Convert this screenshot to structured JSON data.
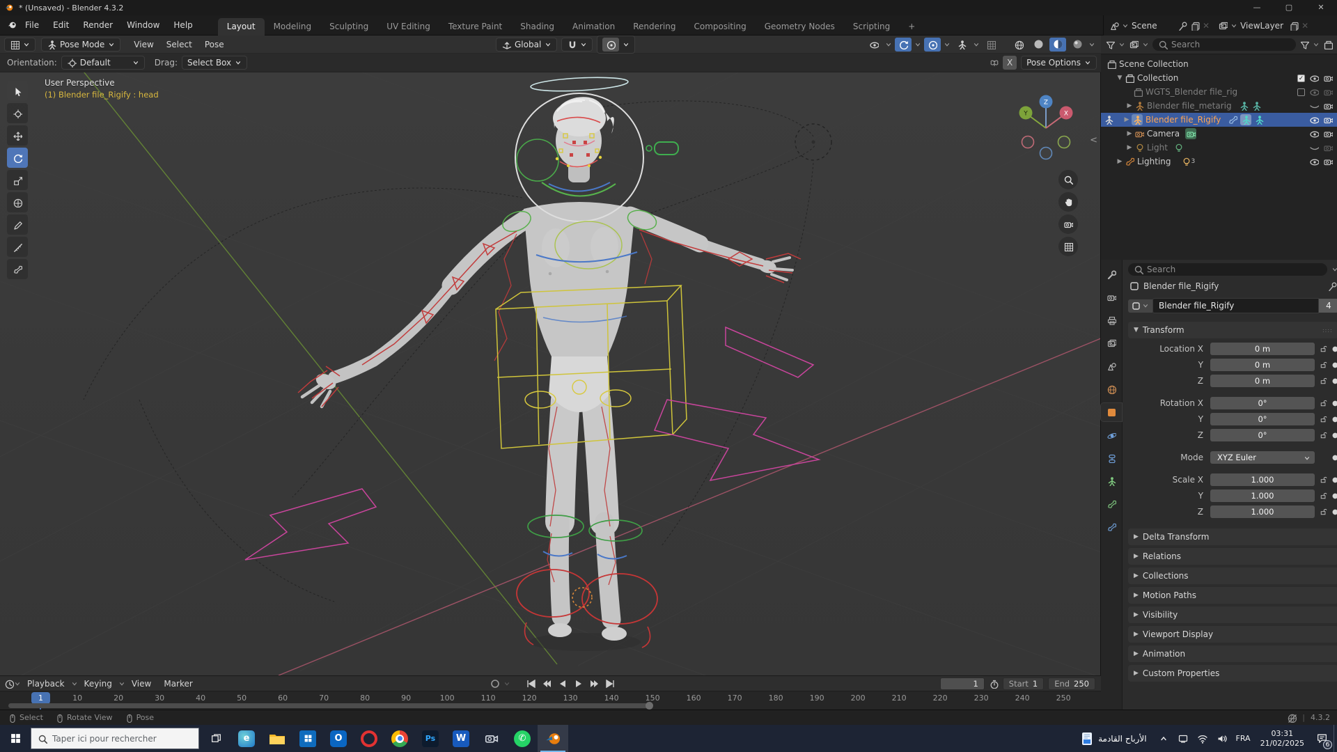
{
  "window": {
    "title": "* (Unsaved) - Blender 4.3.2",
    "minimize": "—",
    "maximize": "▢",
    "close": "✕"
  },
  "menubar": {
    "menus": [
      "File",
      "Edit",
      "Render",
      "Window",
      "Help"
    ],
    "workspaces": [
      "Layout",
      "Modeling",
      "Sculpting",
      "UV Editing",
      "Texture Paint",
      "Shading",
      "Animation",
      "Rendering",
      "Compositing",
      "Geometry Nodes",
      "Scripting"
    ],
    "active_workspace": "Layout",
    "add_tab": "+",
    "scene": "Scene",
    "viewlayer": "ViewLayer"
  },
  "tool_header": {
    "mode": "Pose Mode",
    "menus": [
      "View",
      "Select",
      "Pose"
    ],
    "orientation": "Global"
  },
  "options_row": {
    "orientation_label": "Orientation:",
    "orientation_value": "Default",
    "drag_label": "Drag:",
    "drag_value": "Select Box",
    "mirror_x": "X",
    "pose_options": "Pose Options"
  },
  "viewport": {
    "perspective_label": "User Perspective",
    "active_object_label": "(1) Blender file_Rigify : head",
    "gizmo": {
      "x": "X",
      "y": "Y",
      "z": "Z"
    },
    "collapse_arrow": "<"
  },
  "outliner": {
    "search_placeholder": "Search",
    "rows": [
      {
        "label": "Scene Collection"
      },
      {
        "label": "Collection"
      },
      {
        "label": "WGTS_Blender file_rig"
      },
      {
        "label": "Blender file_metarig"
      },
      {
        "label": "Blender file_Rigify"
      },
      {
        "label": "Camera"
      },
      {
        "label": "Light"
      },
      {
        "label": "Lighting",
        "badge": "3"
      }
    ]
  },
  "properties": {
    "search_placeholder": "Search",
    "breadcrumb": "Blender file_Rigify",
    "object_name": "Blender file_Rigify",
    "users_count": "4",
    "transform_title": "Transform",
    "transform_rows": [
      {
        "label": "Location X",
        "value": "0 m"
      },
      {
        "label": "Y",
        "value": "0 m"
      },
      {
        "label": "Z",
        "value": "0 m"
      },
      {
        "label": "Rotation X",
        "value": "0°"
      },
      {
        "label": "Y",
        "value": "0°"
      },
      {
        "label": "Z",
        "value": "0°"
      },
      {
        "label": "Scale X",
        "value": "1.000"
      },
      {
        "label": "Y",
        "value": "1.000"
      },
      {
        "label": "Z",
        "value": "1.000"
      }
    ],
    "mode_label": "Mode",
    "mode_value": "XYZ Euler",
    "collapsed_sections": [
      "Delta Transform",
      "Relations",
      "Collections",
      "Motion Paths",
      "Visibility",
      "Viewport Display",
      "Animation",
      "Custom Properties"
    ]
  },
  "timeline": {
    "menus": [
      "Playback",
      "Keying",
      "View",
      "Marker"
    ],
    "current_frame": "1",
    "start_label": "Start",
    "start_value": "1",
    "end_label": "End",
    "end_value": "250",
    "ticks": [
      10,
      20,
      30,
      40,
      50,
      60,
      70,
      80,
      90,
      100,
      110,
      120,
      130,
      140,
      150,
      160,
      170,
      180,
      190,
      200,
      210,
      220,
      230,
      240,
      250
    ]
  },
  "statusbar": {
    "items": [
      "Select",
      "Rotate View",
      "Pose"
    ],
    "version": "4.3.2"
  },
  "taskbar": {
    "search_placeholder": "Taper ici pour rechercher",
    "app_label": "الأرباح القادمة",
    "language": "FRA",
    "time": "03:31",
    "date": "21/02/2025",
    "notification_count": "6",
    "apps": [
      "edge",
      "explorer",
      "store",
      "outlook",
      "opera",
      "chrome",
      "photoshop",
      "word",
      "camera",
      "whatsapp",
      "blender"
    ]
  },
  "colors": {
    "accent": "#4772b3",
    "selection_row": "#3a5ca0",
    "active_object_text": "#ffa552",
    "axis_x": "#ca5a6e",
    "axis_y": "#7da33a",
    "axis_z": "#4e84c4",
    "taskbar": "#1d2434"
  }
}
